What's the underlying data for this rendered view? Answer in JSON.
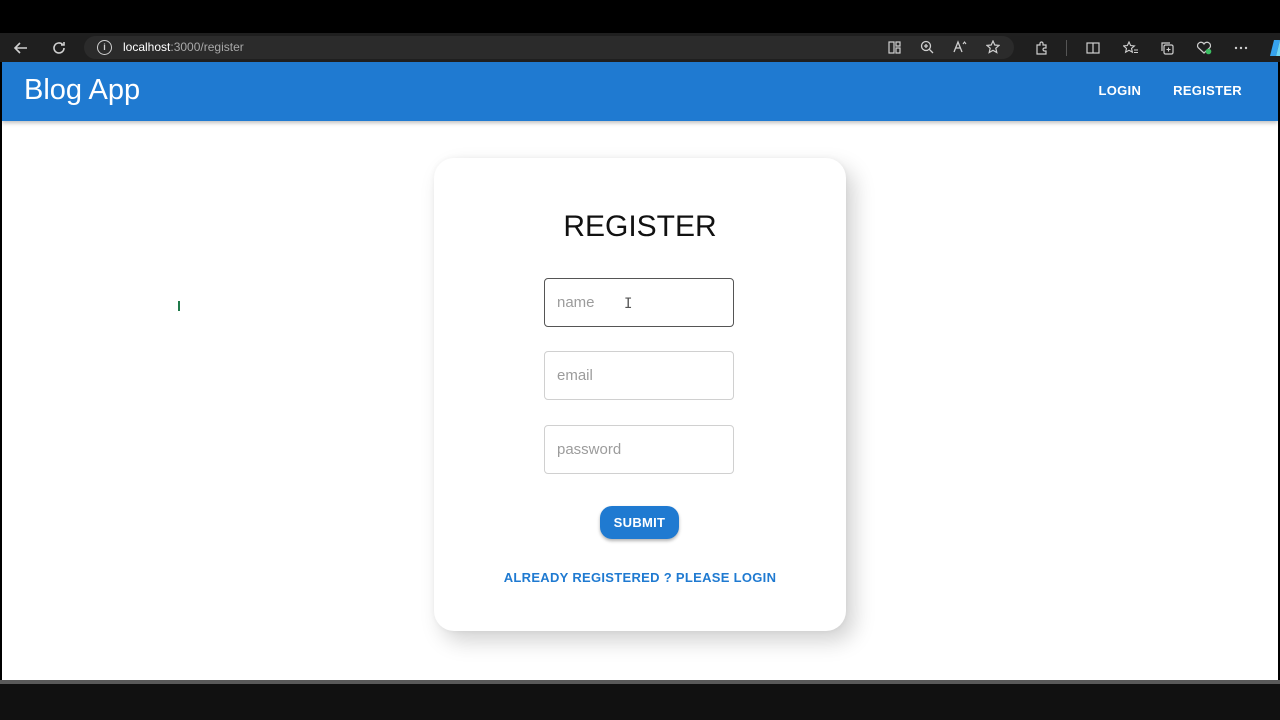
{
  "browser": {
    "url_host": "localhost",
    "url_path": ":3000/register",
    "nav_icons": [
      "back-arrow-icon",
      "refresh-icon"
    ],
    "address_icons": [
      "grid-view-icon",
      "zoom-in-icon",
      "read-aloud-icon",
      "favorite-star-icon"
    ],
    "toolbar_icons": [
      "extensions-icon",
      "split-screen-icon",
      "favorites-icon",
      "collections-icon",
      "health-icon",
      "more-icon",
      "copilot-icon"
    ]
  },
  "app": {
    "brand": "Blog App",
    "nav": {
      "login": "LOGIN",
      "register": "REGISTER"
    },
    "accent_color": "#1f7ad1"
  },
  "form": {
    "title": "REGISTER",
    "fields": {
      "name": {
        "placeholder": "name",
        "value": ""
      },
      "email": {
        "placeholder": "email",
        "value": ""
      },
      "password": {
        "placeholder": "password",
        "value": ""
      }
    },
    "submit_label": "SUBMIT",
    "login_link": "ALREADY REGISTERED ? PLEASE LOGIN"
  }
}
